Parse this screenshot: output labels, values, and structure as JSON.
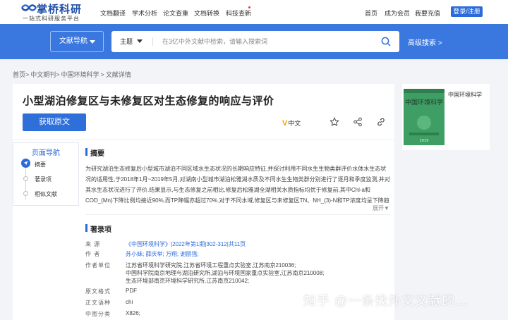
{
  "header": {
    "brand": "掌桥科研",
    "slogan": "一站式科研服务平台",
    "nav": [
      "文档翻译",
      "学术分析",
      "论文查重",
      "文档转换",
      "科技查新"
    ],
    "right_links": [
      "首页",
      "成为会员",
      "我要充值"
    ],
    "login_label": "登录/注册"
  },
  "search": {
    "nav_select_label": "文献导航",
    "topic_label": "主题",
    "placeholder": "在3亿中外文献中检索，请输入搜索词",
    "advanced_label": "高级搜索 >"
  },
  "breadcrumb": [
    "首页>",
    "中文期刊>",
    "中国环境科学",
    ">",
    "文献详情"
  ],
  "article": {
    "title": "小型湖泊修复区与未修复区对生态修复的响应与评价",
    "get_button": "获取原文",
    "lang_badge_v": "V",
    "lang_badge_text": "中文"
  },
  "sidenav": {
    "title": "页面导航",
    "items": [
      "摘要",
      "著录项",
      "相似文献"
    ]
  },
  "abstract": {
    "heading": "摘要",
    "text": "为研究湖泊生态修复后小型城市湖泊不同区域水生态状况的长期响应特征,并探讨利用不同水生生物类群评价水体水生态状况的适用性,于2018年1月~2019年5月,对湖南小型城市湖泊松雅湖水质及不同水生生物类群分别进行了逐月和季度监测,并对其水生态状况进行了评价.结果显示,与生态修复之前相比,修复后松雅湖全湖相关水质指标均优于修复前,其中Chl-a和COD_(Mn)下降比例均接近90%,而TP降幅亦超过70%.对于不同水域,修复区与未修复区TN、NH_(3)-N和TP浓度均呈下降趋势,其他水质指标的变化不大,变化相对较小.但大部分指标均以修复区为更优;其中,修复区COD_(Mn)浓",
    "expand_label": "展开▼"
  },
  "record": {
    "heading": "著录项",
    "rows": [
      {
        "k": "来    源",
        "v": "《中国环境科学》|2022年第1期|302-312|共11页",
        "link": true
      },
      {
        "k": "作    者",
        "v": "苏小妹; 薛庆举; 万翔; 谢丽强;",
        "link": true
      },
      {
        "k": "作者单位",
        "v": "江苏省环境科学研究院,江苏省环境工程重点实验室,江苏南京210036;",
        "link": false
      },
      {
        "k": "",
        "v": "中国科学院南京地理与湖泊研究所,湖泊与环境国家重点实验室,江苏南京210008;",
        "link": false
      },
      {
        "k": "",
        "v": "生态环境部南京环境科学研究所,江苏南京210042;",
        "link": false
      },
      {
        "k": "原文格式",
        "v": "PDF",
        "link": false
      },
      {
        "k": "正文语种",
        "v": "chi",
        "link": false
      },
      {
        "k": "中图分类",
        "v": "X826;",
        "link": false
      }
    ]
  },
  "journal": {
    "name": "中国环境科学",
    "cover_title": "中国环境科学",
    "cover_year": "2019"
  },
  "watermark": "知乎 @一条找外文文献的..."
}
